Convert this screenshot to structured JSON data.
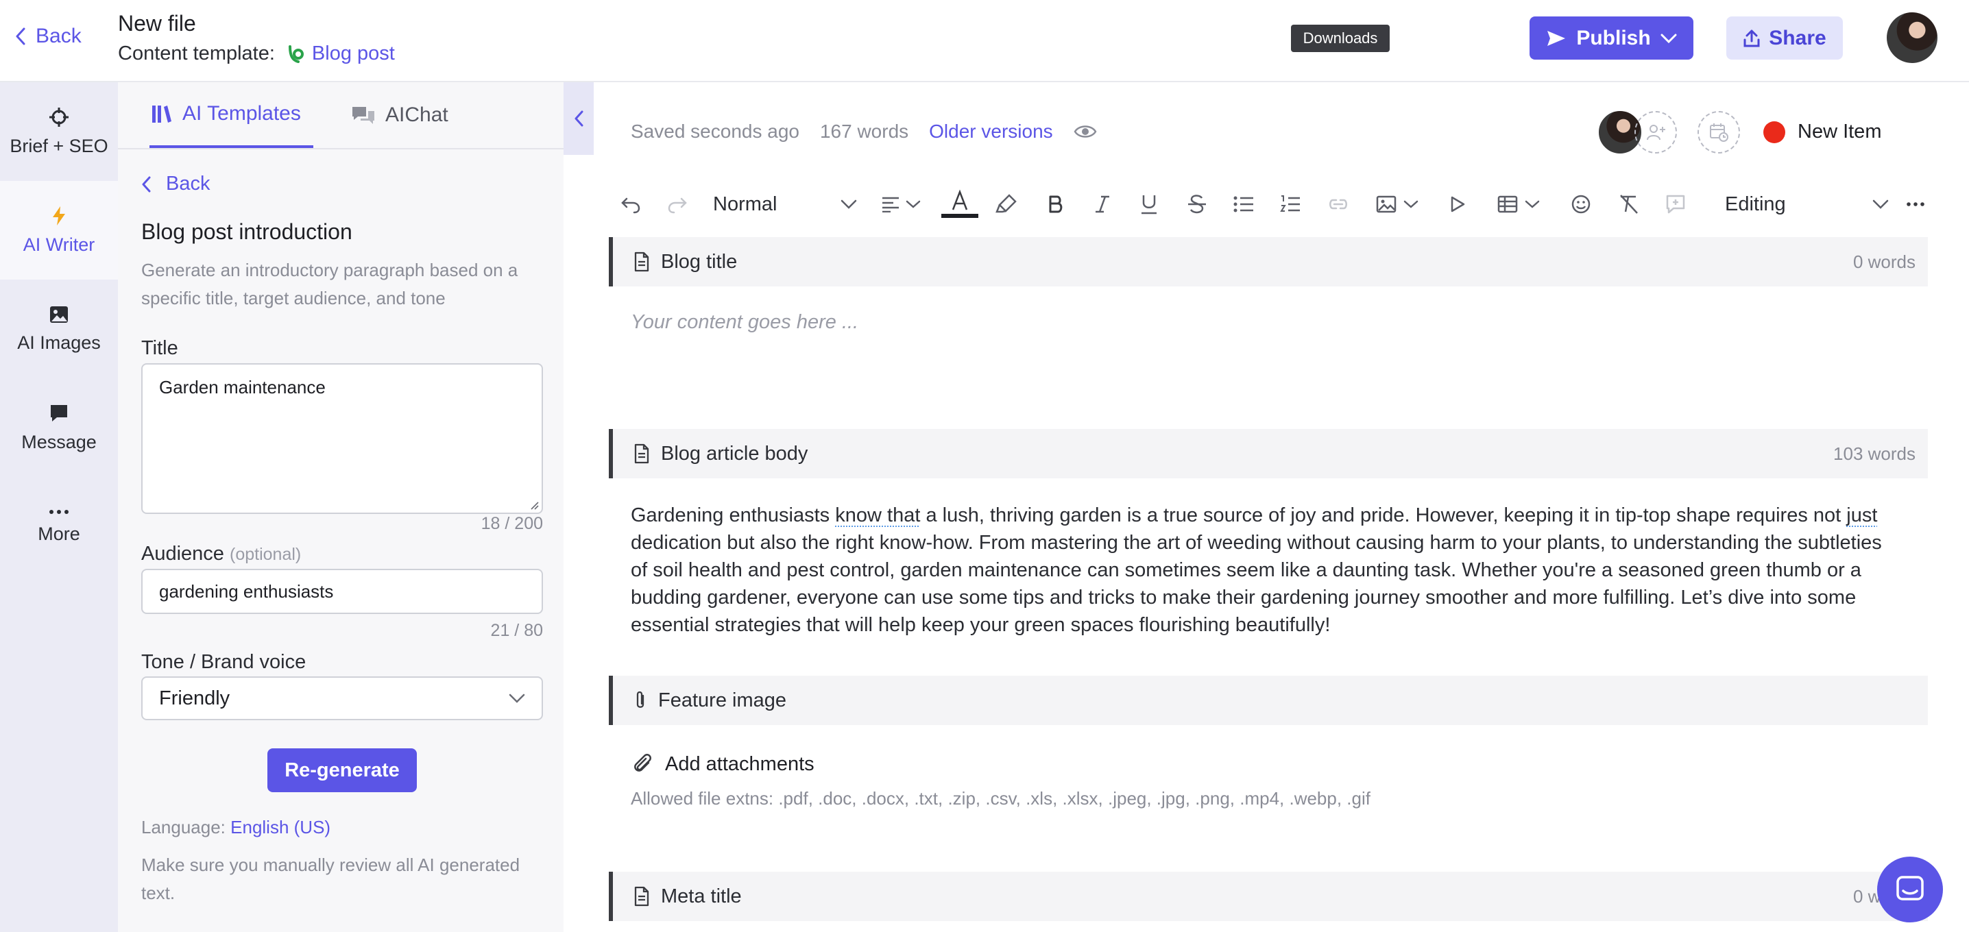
{
  "header": {
    "back_label": "Back",
    "file_title": "New file",
    "template_prefix": "Content template:",
    "template_name": "Blog post",
    "tooltip": "Downloads",
    "publish_label": "Publish",
    "share_label": "Share"
  },
  "rail": {
    "items": [
      {
        "label": "Brief + SEO",
        "icon": "target-icon"
      },
      {
        "label": "AI Writer",
        "icon": "lightning-icon",
        "active": true
      },
      {
        "label": "AI Images",
        "icon": "image-icon"
      },
      {
        "label": "Message",
        "icon": "message-icon"
      },
      {
        "label": "More",
        "icon": "more-icon"
      }
    ]
  },
  "panel": {
    "tabs": [
      {
        "label": "AI Templates",
        "active": true
      },
      {
        "label": "AIChat",
        "active": false
      }
    ],
    "back_label": "Back",
    "heading": "Blog post introduction",
    "description": "Generate an introductory paragraph based on a specific title, target audience, and tone",
    "title_label": "Title",
    "title_value": "Garden maintenance",
    "title_counter": "18 / 200",
    "audience_label": "Audience",
    "audience_optional": "(optional)",
    "audience_value": "gardening enthusiasts",
    "audience_counter": "21 / 80",
    "tone_label": "Tone / Brand voice",
    "tone_value": "Friendly",
    "regenerate_label": "Re-generate",
    "language_prefix": "Language:",
    "language_value": "English (US)",
    "note": "Make sure you manually review all AI generated text."
  },
  "editor": {
    "saved": "Saved seconds ago",
    "word_count": "167 words",
    "older_versions": "Older versions",
    "new_item_label": "New Item",
    "toolbar": {
      "style": "Normal",
      "mode": "Editing"
    },
    "sections": [
      {
        "title": "Blog title",
        "words": "0 words",
        "placeholder": "Your content goes here ..."
      },
      {
        "title": "Blog article body",
        "words": "103 words",
        "body": [
          "Gardening enthusiasts ",
          "know that",
          " a lush, thriving garden is a true source of joy and pride. However, keeping it in tip-top shape requires not ",
          "just",
          " dedication but also the right know-how. From mastering the art of weeding without causing harm to your plants, to understanding the subtleties of soil health and pest control, garden maintenance can sometimes seem like a daunting task. Whether you're a seasoned green thumb or a budding gardener, everyone can use some tips and tricks to make their gardening journey smoother and more fulfilling. Let’s dive into some essential strategies that will help keep your green spaces flourishing beautifully!"
        ]
      },
      {
        "title": "Feature image",
        "add_label": "Add attachments",
        "allowed": "Allowed file extns: .pdf, .doc, .docx, .txt, .zip, .csv, .xls, .xlsx, .jpeg, .jpg, .png, .mp4, .webp, .gif"
      },
      {
        "title": "Meta title",
        "words": "0 words"
      }
    ]
  },
  "colors": {
    "accent": "#5b55e6",
    "accent_soft": "#e3e4fb",
    "status_dot": "#ea2a1a",
    "rail_bg": "#ebebf5"
  }
}
